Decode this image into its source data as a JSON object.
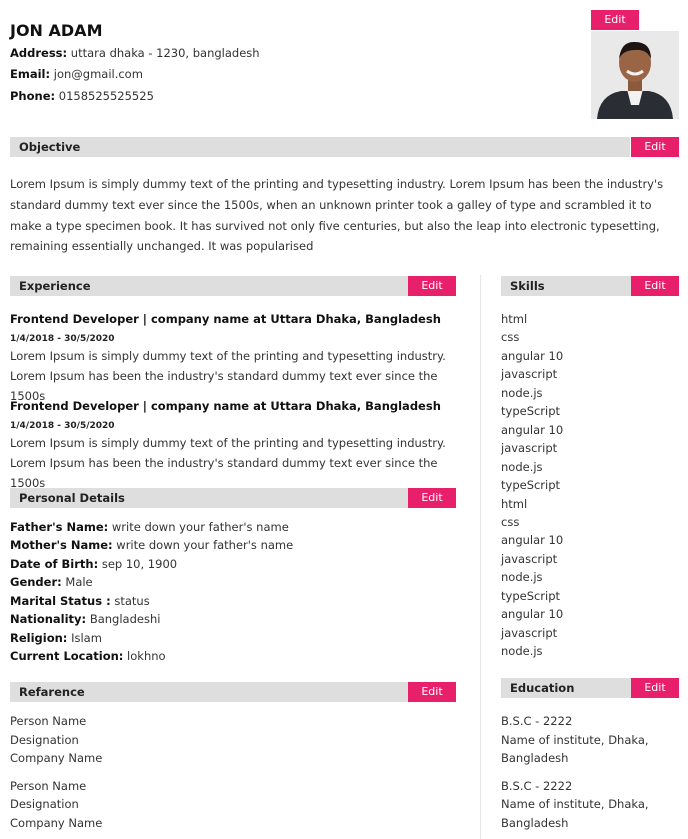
{
  "header": {
    "name": "JON ADAM",
    "address_label": "Address:",
    "address": "uttara dhaka - 1230, bangladesh",
    "email_label": "Email:",
    "email": "jon@gmail.com",
    "phone_label": "Phone:",
    "phone": "0158525525525",
    "edit_label": "Edit"
  },
  "objective": {
    "title": "Objective",
    "edit_label": "Edit",
    "text": "Lorem Ipsum is simply dummy text of the printing and typesetting industry. Lorem Ipsum has been the industry's standard dummy text ever since the 1500s, when an unknown printer took a galley of type and scrambled it to make a type specimen book. It has survived not only five centuries, but also the leap into electronic typesetting, remaining essentially unchanged. It was popularised"
  },
  "experience": {
    "title": "Experience",
    "edit_label": "Edit",
    "items": [
      {
        "role": "Frontend Developer | company name at Uttara Dhaka, Bangladesh",
        "dates": "1/4/2018 - 30/5/2020",
        "description": "Lorem Ipsum is simply dummy text of the printing and typesetting industry. Lorem Ipsum has been the industry's standard dummy text ever since the 1500s"
      },
      {
        "role": "Frontend Developer | company name at Uttara Dhaka, Bangladesh",
        "dates": "1/4/2018 - 30/5/2020",
        "description": "Lorem Ipsum is simply dummy text of the printing and typesetting industry. Lorem Ipsum has been the industry's standard dummy text ever since the 1500s"
      }
    ]
  },
  "personal": {
    "title": "Personal Details",
    "edit_label": "Edit",
    "fields": [
      {
        "label": "Father's Name:",
        "value": "write down your father's name"
      },
      {
        "label": "Mother's Name:",
        "value": "write down your father's name"
      },
      {
        "label": "Date of Birth:",
        "value": "sep 10, 1900"
      },
      {
        "label": "Gender:",
        "value": "Male"
      },
      {
        "label": "Marital Status :",
        "value": "status"
      },
      {
        "label": "Nationality:",
        "value": "Bangladeshi"
      },
      {
        "label": "Religion:",
        "value": "Islam"
      },
      {
        "label": "Current Location:",
        "value": "lokhno"
      }
    ]
  },
  "reference": {
    "title": "Refarence",
    "edit_label": "Edit",
    "items": [
      {
        "name": "Person Name",
        "designation": "Designation",
        "company": "Company Name"
      },
      {
        "name": "Person Name",
        "designation": "Designation",
        "company": "Company Name"
      }
    ]
  },
  "skills": {
    "title": "Skills",
    "edit_label": "Edit",
    "items": [
      "html",
      "css",
      "angular 10",
      "javascript",
      "node.js",
      "typeScript",
      "angular 10",
      "javascript",
      "node.js",
      "typeScript",
      "html",
      "css",
      "angular 10",
      "javascript",
      "node.js",
      "typeScript",
      "angular 10",
      "javascript",
      "node.js"
    ]
  },
  "education": {
    "title": "Education",
    "edit_label": "Edit",
    "items": [
      {
        "degree": "B.S.C - 2222",
        "institute_line1": "Name of institute, Dhaka,",
        "institute_line2": "Bangladesh"
      },
      {
        "degree": "B.S.C - 2222",
        "institute_line1": "Name of institute, Dhaka,",
        "institute_line2": "Bangladesh"
      }
    ]
  },
  "colors": {
    "accent": "#e8206b",
    "section_bar": "#dedede"
  },
  "icons": {
    "profile_photo": "avatar-photo"
  }
}
